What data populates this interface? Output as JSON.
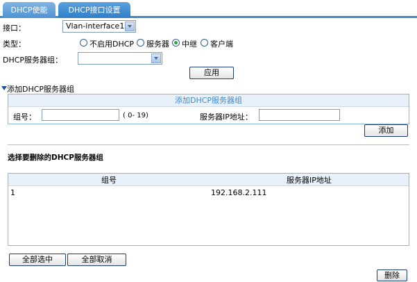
{
  "tabs": [
    {
      "label": "DHCP使能",
      "active": false
    },
    {
      "label": "DHCP接口设置",
      "active": true
    }
  ],
  "form": {
    "interface_label": "接口：",
    "interface_value": "Vlan-interface1",
    "type_label": "类型：",
    "type_options": [
      "不启用DHCP",
      "服务器",
      "中继",
      "客户端"
    ],
    "type_selected": "中继",
    "server_group_label": "DHCP服务器组：",
    "server_group_value": "",
    "apply_label": "应用"
  },
  "add_section": {
    "toggle_label": "添加DHCP服务器组",
    "panel_title": "添加DHCP服务器组",
    "group_label": "组号：",
    "group_value": "",
    "group_range": "( 0- 19)",
    "ip_label": "服务器IP地址：",
    "ip_value": "",
    "add_label": "添加"
  },
  "delete_section": {
    "title": "选择要删除的DHCP服务器组",
    "columns": [
      "组号",
      "服务器IP地址"
    ],
    "rows": [
      {
        "group": "1",
        "ip": "192.168.2.111"
      }
    ],
    "select_all_label": "全部选中",
    "deselect_all_label": "全部取消",
    "delete_label": "删除"
  },
  "colors": {
    "accent": "#3f89c9",
    "radio_checked": "#2fa82f"
  }
}
